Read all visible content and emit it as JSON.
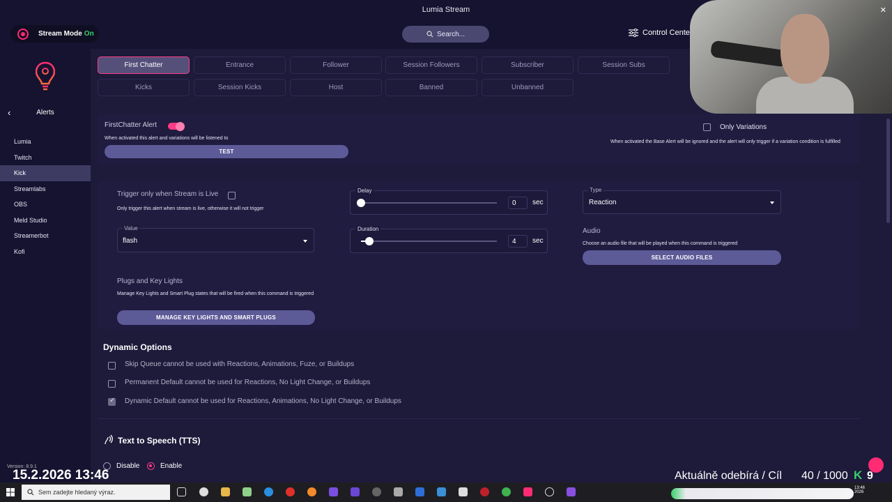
{
  "app": {
    "title": "Lumia Stream"
  },
  "topbar": {
    "stream_mode_label": "Stream Mode",
    "stream_mode_state": "On",
    "search_label": "Search...",
    "control_center_label": "Control Center"
  },
  "sidebar": {
    "title": "Alerts",
    "items": [
      {
        "label": "Lumia"
      },
      {
        "label": "Twitch"
      },
      {
        "label": "Kick"
      },
      {
        "label": "Streamlabs"
      },
      {
        "label": "OBS"
      },
      {
        "label": "Meld Studio"
      },
      {
        "label": "Streamerbot"
      },
      {
        "label": "Kofi"
      }
    ],
    "version": "Version: 8.9.1"
  },
  "tabs": {
    "row1": [
      "First Chatter",
      "Entrance",
      "Follower",
      "Session Followers",
      "Subscriber",
      "Session Subs"
    ],
    "row2": [
      "Kicks",
      "Session Kicks",
      "Host",
      "Banned",
      "Unbanned"
    ]
  },
  "alert": {
    "name": "FirstChatter Alert",
    "desc": "When activated this alert and variations will be listened to",
    "test_label": "TEST",
    "only_variations_label": "Only Variations",
    "only_variations_desc": "When activated the Base Alert will be ignored and the alert will only trigger if a variation condition is fulfilled"
  },
  "settings": {
    "trigger_live_label": "Trigger only when Stream is Live",
    "trigger_live_desc": "Only trigger this alert when stream is live, otherwise it will not trigger",
    "value_label": "Value",
    "value": "flash",
    "delay_label": "Delay",
    "delay_value": "0",
    "delay_unit": "sec",
    "delay_fraction": 0.0,
    "duration_label": "Duration",
    "duration_value": "4",
    "duration_unit": "sec",
    "duration_fraction": 0.06,
    "type_label": "Type",
    "type_value": "Reaction",
    "audio_label": "Audio",
    "audio_desc": "Choose an audio file that will be played when this command is triggered",
    "audio_button": "SELECT AUDIO FILES",
    "plugs_label": "Plugs and Key Lights",
    "plugs_desc": "Manage Key Lights and Smart Plug states that will be fired when this command is triggered",
    "plugs_button": "MANAGE KEY LIGHTS AND SMART PLUGS"
  },
  "dynamic": {
    "title": "Dynamic Options",
    "options": [
      {
        "label": "Skip Queue cannot be used with Reactions, Animations, Fuze, or Buildups",
        "checked": false
      },
      {
        "label": "Permanent Default cannot be used for Reactions, No Light Change, or Buildups",
        "checked": false
      },
      {
        "label": "Dynamic Default cannot be used for Reactions, Animations, No Light Change, or Buildups",
        "checked": true
      }
    ]
  },
  "tts": {
    "title": "Text to Speech (TTS)",
    "disable_label": "Disable",
    "enable_label": "Enable"
  },
  "overlay": {
    "datetime": "15.2.2026 13:46",
    "subs_text": "Aktuálně odebírá / Cíl",
    "subs_count": "40 / 1000",
    "kick_count": "9",
    "kick_letter": "K"
  },
  "taskbar": {
    "search_placeholder": "Sem zadejte hledaný výraz."
  },
  "colors": {
    "accent": "#ff3b86",
    "button": "#5d5a98",
    "background": "#1d1a3a"
  }
}
